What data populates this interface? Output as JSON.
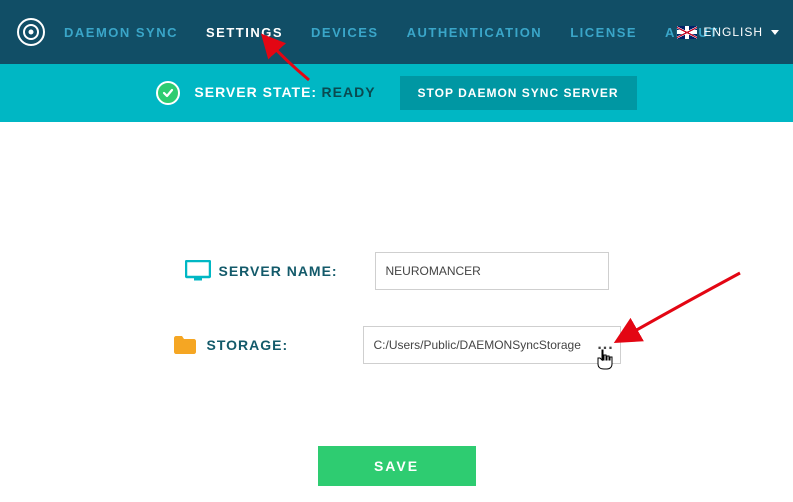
{
  "nav": {
    "items": [
      {
        "label": "DAEMON SYNC"
      },
      {
        "label": "SETTINGS"
      },
      {
        "label": "DEVICES"
      },
      {
        "label": "AUTHENTICATION"
      },
      {
        "label": "LICENSE"
      },
      {
        "label": "ABOUT"
      }
    ],
    "active_index": 1,
    "language": "ENGLISH"
  },
  "status": {
    "label": "SERVER STATE:",
    "value": "READY",
    "stop_button": "STOP DAEMON SYNC SERVER"
  },
  "form": {
    "server_name_label": "SERVER NAME:",
    "server_name_value": "NEUROMANCER",
    "storage_label": "STORAGE:",
    "storage_value": "C:/Users/Public/DAEMONSyncStorage",
    "browse_glyph": "..."
  },
  "save_label": "SAVE",
  "colors": {
    "navbar": "#114e66",
    "statusbar": "#00b7c4",
    "accent_green": "#2ecc71",
    "accent_orange": "#f5a623"
  }
}
